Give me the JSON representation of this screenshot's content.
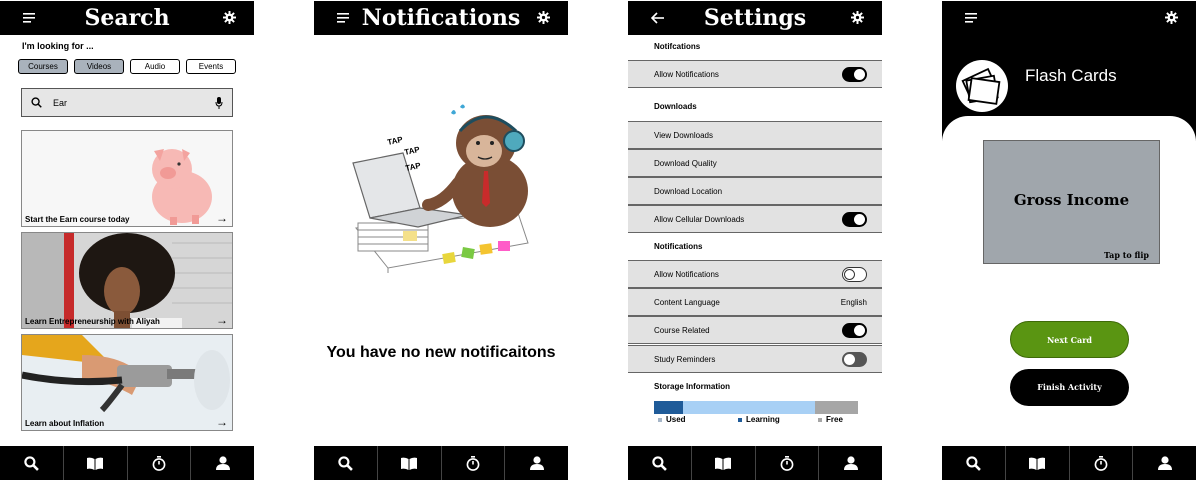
{
  "search": {
    "title": "Search",
    "looking_for": "I'm looking for ...",
    "chips": [
      "Courses",
      "Videos",
      "Audio",
      "Events"
    ],
    "query": "Ear",
    "cards": [
      {
        "label": "Start the Earn course today",
        "arrow": "→"
      },
      {
        "label": "Learn Entrepreneurship with Aliyah",
        "arrow": "→"
      },
      {
        "label": "Learn about Inflation",
        "arrow": "→"
      }
    ]
  },
  "notifications": {
    "title": "Notifications",
    "illustration_text": [
      "TAP",
      "TAP",
      "TAP"
    ],
    "empty_message": "You have no new notificaitons"
  },
  "settings": {
    "title": "Settings",
    "sections": {
      "notifications_top": "Notifcations",
      "downloads": "Downloads",
      "notifications": "Notifications",
      "storage": "Storage Information"
    },
    "rows": {
      "allow_notifications_1": "Allow Notifications",
      "view_downloads": "View Downloads",
      "download_quality": "Download Quality",
      "download_location": "Download Location",
      "allow_cellular": "Allow Cellular Downloads",
      "allow_notifications_2": "Allow Notifications",
      "content_language": "Content Language",
      "content_language_value": "English",
      "course_related": "Course Related",
      "study_reminders": "Study Reminders"
    },
    "toggles": {
      "allow_notifications_1": true,
      "allow_cellular": true,
      "allow_notifications_2": false,
      "course_related": true,
      "study_reminders": true
    },
    "storage": {
      "legend": [
        "Used",
        "Learning",
        "Free"
      ],
      "fractions": [
        0.14,
        0.65,
        0.21
      ],
      "colors": [
        "#1f5b99",
        "#a8d0f5",
        "#a6a6a6"
      ]
    }
  },
  "flashcards": {
    "title": "Flash Cards",
    "term": "Gross Income",
    "tap_to_flip": "Tap to flip",
    "next_card": "Next Card",
    "finish_activity": "Finish Activity"
  },
  "nav": {
    "icons": [
      "search-icon",
      "book-icon",
      "timer-icon",
      "profile-icon"
    ]
  },
  "colors": {
    "bar": "#000000",
    "green_button": "#5a9512",
    "chip_active": "#a9b2bc",
    "flashcard": "#a0a6ac"
  }
}
